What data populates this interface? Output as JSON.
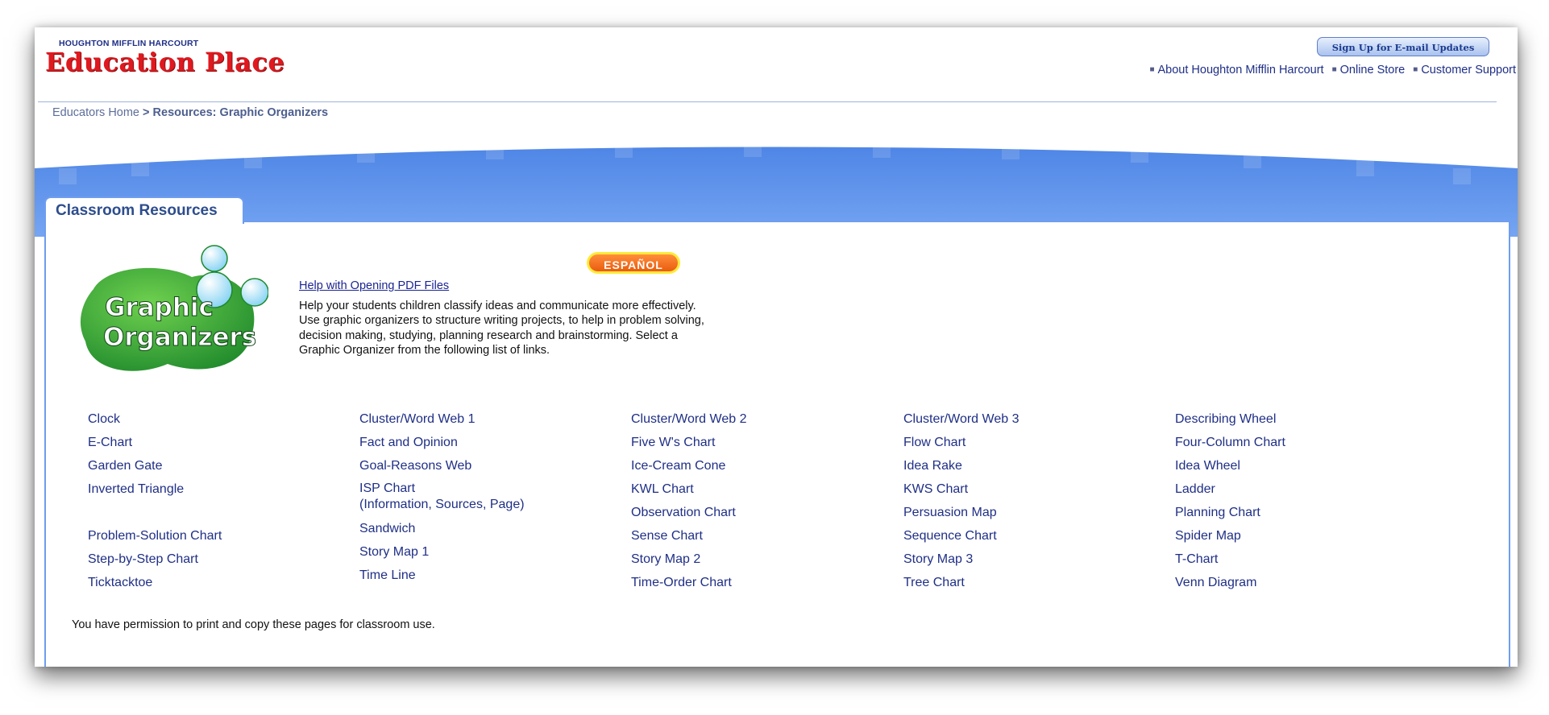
{
  "header": {
    "brand_small": "HOUGHTON MIFFLIN HARCOURT",
    "brand_big": "Education Place",
    "signup_label": "Sign Up for E-mail Updates",
    "top_links": [
      "About Houghton Mifflin Harcourt",
      "Online Store",
      "Customer Support"
    ]
  },
  "breadcrumb": {
    "home": "Educators Home",
    "separator": ">",
    "current": "Resources: Graphic Organizers"
  },
  "tab": {
    "label": "Classroom Resources"
  },
  "logo": {
    "line1": "Graphic",
    "line2": "Organizers"
  },
  "espanol_label": "ESPAÑOL",
  "help_link": "Help with Opening PDF Files",
  "intro": "Help your students children classify ideas and communicate more effectively. Use graphic organizers to structure writing projects, to help in problem solving, decision making, studying, planning research and brainstorming. Select a Graphic Organizer from the following list of links.",
  "organizers": {
    "col1": [
      "Clock",
      "E-Chart",
      "Garden Gate",
      "Inverted Triangle",
      "Problem-Solution Chart",
      "Step-by-Step Chart",
      "Ticktacktoe"
    ],
    "col2": [
      "Cluster/Word Web 1",
      "Fact and Opinion",
      "Goal-Reasons Web",
      "ISP Chart",
      "(Information, Sources, Page)",
      "Sandwich",
      "Story Map 1",
      "Time Line"
    ],
    "col3": [
      "Cluster/Word Web 2",
      "Five W's Chart",
      "Ice-Cream Cone",
      "KWL Chart",
      "Observation Chart",
      "Sense Chart",
      "Story Map 2",
      "Time-Order Chart"
    ],
    "col4": [
      "Cluster/Word Web 3",
      "Flow Chart",
      "Idea Rake",
      "KWS Chart",
      "Persuasion Map",
      "Sequence Chart",
      "Story Map 3",
      "Tree Chart"
    ],
    "col5": [
      "Describing Wheel",
      "Four-Column Chart",
      "Idea Wheel",
      "Ladder",
      "Planning Chart",
      "Spider Map",
      "T-Chart",
      "Venn Diagram"
    ]
  },
  "footer_note": "You have permission to print and copy these pages for classroom use.",
  "colors": {
    "link": "#1f2f86",
    "brand_red": "#e0191f",
    "band_blue": "#6e9df0",
    "espanol_orange": "#ef6a1a"
  }
}
